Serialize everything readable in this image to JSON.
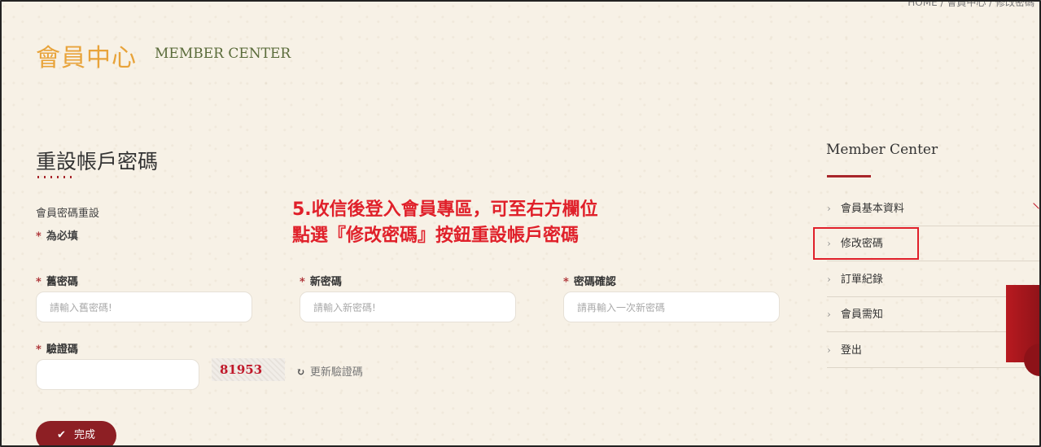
{
  "breadcrumb": "HOME / 會員中心 / 修改密碼",
  "header": {
    "title_zh": "會員中心",
    "title_en": "MEMBER CENTER"
  },
  "page": {
    "title": "重設帳戶密碼",
    "subtitle": "會員密碼重設",
    "required_note": "為必填"
  },
  "form": {
    "old_password": {
      "label": "舊密碼",
      "placeholder": "請輸入舊密碼!"
    },
    "new_password": {
      "label": "新密碼",
      "placeholder": "請輸入新密碼!"
    },
    "confirm_password": {
      "label": "密碼確認",
      "placeholder": "請再輸入一次新密碼"
    },
    "captcha": {
      "label": "驗證碼",
      "value": "",
      "code": "81953",
      "refresh_label": "更新驗證碼"
    },
    "submit_label": "完成"
  },
  "annotation": {
    "line1": "5.收信後登入會員專區，可至右方欄位",
    "line2": "點選『修改密碼』按鈕重設帳戶密碼"
  },
  "sidebar": {
    "title": "Member Center",
    "items": [
      {
        "label": "會員基本資料"
      },
      {
        "label": "修改密碼"
      },
      {
        "label": "訂單紀錄"
      },
      {
        "label": "會員需知"
      },
      {
        "label": "登出"
      }
    ]
  },
  "colors": {
    "accent": "#a8252a",
    "heading": "#e8a33a",
    "annotation": "#e0202a"
  }
}
